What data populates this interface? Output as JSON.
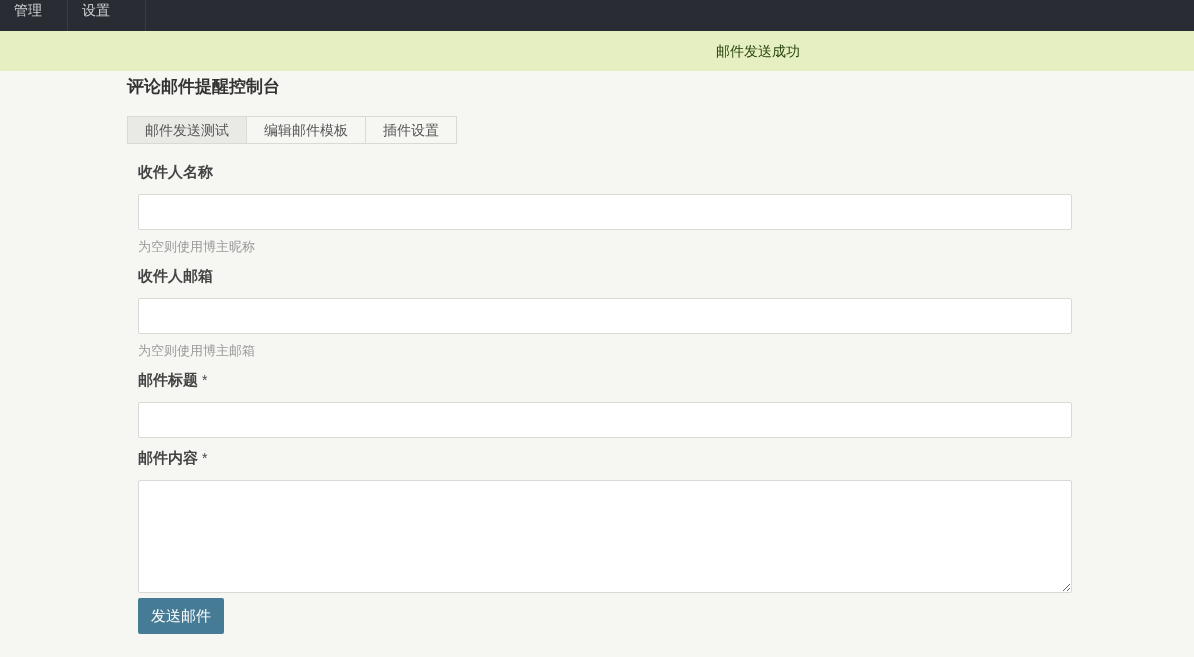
{
  "nav": [
    {
      "label": "管理"
    },
    {
      "label": "设置"
    }
  ],
  "notice": "邮件发送成功",
  "title": "评论邮件提醒控制台",
  "tabs": [
    {
      "label": "邮件发送测试",
      "selected": true
    },
    {
      "label": "编辑邮件模板",
      "selected": false
    },
    {
      "label": "插件设置",
      "selected": false
    }
  ],
  "fields": [
    {
      "label": "收件人名称",
      "kind": "input",
      "description": "为空则使用博主昵称"
    },
    {
      "label": "收件人邮箱",
      "kind": "input",
      "description": "为空则使用博主邮箱"
    },
    {
      "label": "邮件标题",
      "required_mark": "*",
      "kind": "input"
    },
    {
      "label": "邮件内容",
      "required_mark": "*",
      "kind": "textarea"
    }
  ],
  "submit": "发送邮件"
}
